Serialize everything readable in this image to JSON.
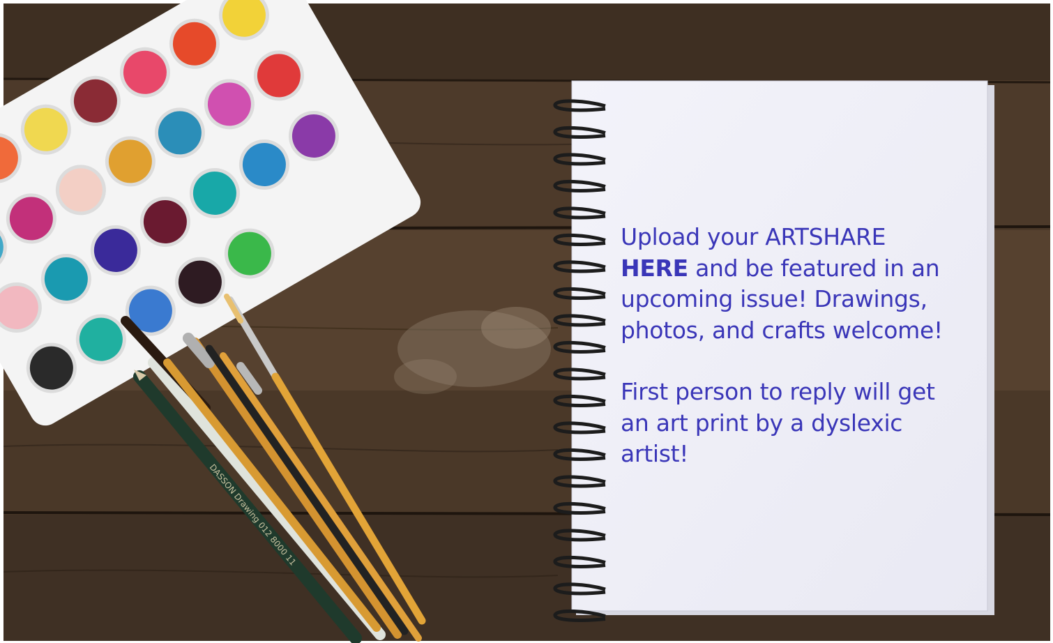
{
  "note": {
    "line1_before": "Upload your ARTSHARE",
    "link_text": "HERE",
    "line1_after": " and be featured in an upcoming issue! Drawings, photos, and crafts welcome!",
    "line2": "First person to reply will get an art print by a dyslexic artist!"
  },
  "brush_imprint": "DASSON Drawing 012 8000 11",
  "colors": {
    "text": "#3a36b8",
    "table_dark": "#3b2a1d",
    "table_mid": "#5a4330",
    "palette_tray": "#f4f4f4",
    "paper": "#f6f6fb",
    "spiral": "#1c1c1c"
  },
  "paint_colors": [
    "#e8788f",
    "#f06a3a",
    "#f0d850",
    "#8a2b35",
    "#e8486a",
    "#e64a2a",
    "#f2d238",
    "#40a8c8",
    "#c2307a",
    "#f3cfc5",
    "#e0a030",
    "#2b8eb8",
    "#d050b0",
    "#e03a3a",
    "#f2b8c0",
    "#1a9ab0",
    "#3a2a9a",
    "#6a1a30",
    "#18a8a8",
    "#2a8ac8",
    "#8a3aa8",
    "#2a2a2a",
    "#20b0a0",
    "#3a7ad0",
    "#2e1b22",
    "#3ab84a"
  ]
}
